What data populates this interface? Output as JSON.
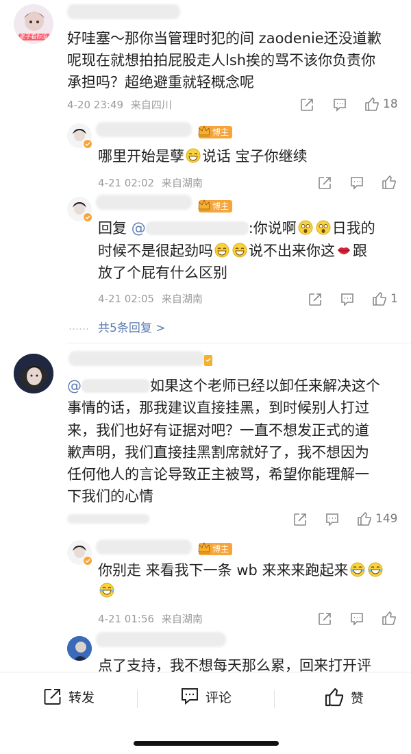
{
  "comment1": {
    "text_line1": "好哇塞～那你当管理时犯的间 zaodenie还没道歉",
    "text_line2": "呢现在就想拍拍屁股走人lsh挨的骂不该你负责你",
    "text_line3": "承担吗？超绝避重就轻概念呢",
    "time": "4-20 23:49",
    "location": "来自四川",
    "like_count": "18",
    "avatar_caption": "老子看你没"
  },
  "reply1": {
    "badge": "博主",
    "text_a": "哪里开始是孽",
    "text_b": "说话 宝子你继续",
    "time": "4-21 02:02",
    "location": "来自湖南"
  },
  "reply2": {
    "badge": "博主",
    "prefix": "回复",
    "at": "@",
    "line1_a": ":你说啊",
    "line1_b": "日我的",
    "line2_a": "时候不是很起劲吗",
    "line2_b": "说不出来你这",
    "line2_c": "跟",
    "line3": "放了个屁有什么区别",
    "time": "4-21 02:05",
    "location": "来自湖南",
    "like_count": "1"
  },
  "more_replies": {
    "dots": "……",
    "label": "共5条回复 >"
  },
  "comment2": {
    "at": "@",
    "line1": "如果这个老师已经以卸任来解决这个",
    "line2": "事情的话，那我建议直接挂黑，到时候别人打过",
    "line3": "来，我们也好有证据对吧？一直不想发正式的道",
    "line4": "歉声明，我们直接挂黑割席就好了，我不想因为",
    "line5": "任何他人的言论导致正主被骂，希望你能理解一",
    "line6": "下我们的心情",
    "like_count": "149"
  },
  "reply3": {
    "badge": "博主",
    "text": "你别走 来看我下一条 wb 来来来跑起来",
    "time": "4-21 01:56",
    "location": "来自湖南"
  },
  "reply4": {
    "text": "点了支持，我不想每天那么累，回来打开评"
  },
  "bottom_bar": {
    "repost": "转发",
    "comment": "评论",
    "like": "赞"
  },
  "icons": {
    "repost": "share-icon",
    "comment": "comment-icon",
    "like": "thumbs-up-icon"
  },
  "colors": {
    "mention": "#5a7cb0",
    "badge": "#f7a53a",
    "meta": "#9a9a9a"
  }
}
